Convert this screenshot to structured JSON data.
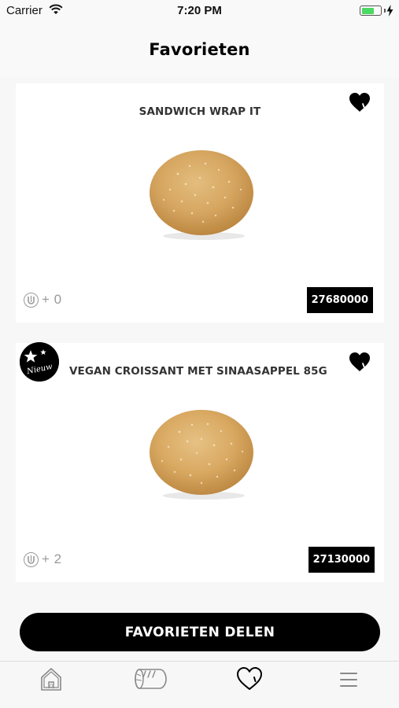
{
  "status_bar": {
    "carrier": "Carrier",
    "time": "7:20 PM"
  },
  "header": {
    "title": "Favorieten"
  },
  "products": [
    {
      "name": "SANDWICH WRAP IT",
      "points": "+ 0",
      "article_code": "27680000",
      "favorite": true,
      "new_badge": false
    },
    {
      "name": "VEGAN CROISSANT MET SINAASAPPEL 85G",
      "points": "+ 2",
      "article_code": "27130000",
      "favorite": true,
      "new_badge": true,
      "badge_text": "Nieuw"
    }
  ],
  "share_button": {
    "label": "FAVORIETEN DELEN"
  },
  "tab_bar": {
    "items": [
      {
        "icon": "home-icon",
        "active": false
      },
      {
        "icon": "bread-icon",
        "active": false
      },
      {
        "icon": "heart-icon",
        "active": true
      },
      {
        "icon": "menu-icon",
        "active": false
      }
    ]
  },
  "colors": {
    "accent": "#000000",
    "battery": "#4cd964",
    "muted": "#999999"
  }
}
